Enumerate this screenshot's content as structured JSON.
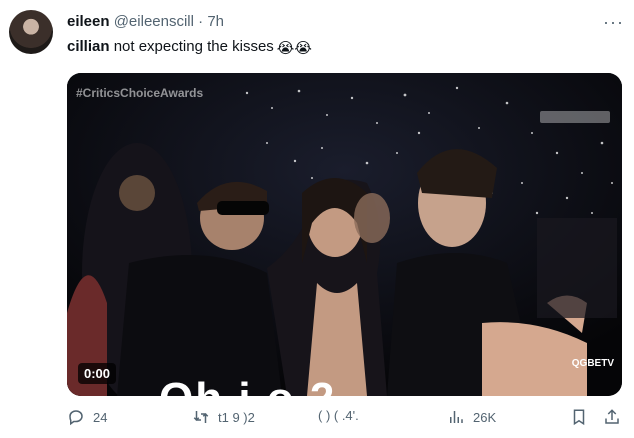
{
  "tweet": {
    "display_name": "eileen",
    "handle": "@eileenscill",
    "separator": "·",
    "time": "7h",
    "text_bold": "cillian",
    "text_rest": " not expecting the kisses",
    "emoji": "😭😭"
  },
  "media": {
    "hashtag": "#CriticsChoiceAwards",
    "timecode": "0:00",
    "logo": "QGBETV",
    "caption_fragment": "Oh i   o 2"
  },
  "actions": {
    "replies": "24",
    "retweets": "t1 9 )2",
    "likes": "( ) ( .4'.",
    "views": "26K"
  },
  "colors": {
    "text": "#0f1419",
    "muted": "#536471",
    "background": "#ffffff",
    "media_bg": "#0b0b10"
  },
  "icons": [
    "more-icon",
    "reply-icon",
    "retweet-icon",
    "like-icon",
    "views-icon",
    "bookmark-icon",
    "share-icon"
  ]
}
